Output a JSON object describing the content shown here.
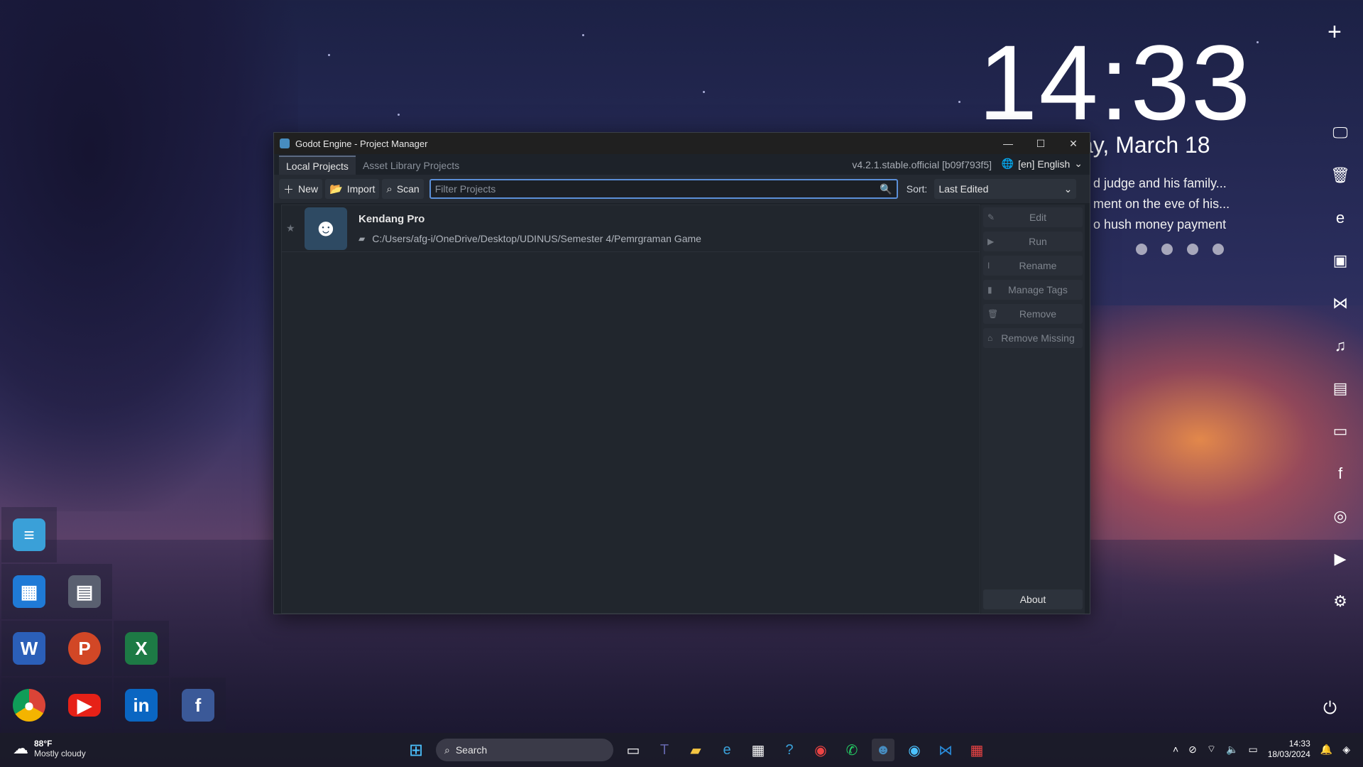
{
  "desktop": {
    "clock_time": "14:33",
    "clock_date": "ay, March 18",
    "news_lines": [
      "d judge and his family...",
      "ment on the eve of his...",
      "o hush money payment"
    ],
    "add_widget": "+"
  },
  "window": {
    "title": "Godot Engine - Project Manager",
    "tabs": [
      {
        "label": "Local Projects",
        "active": true
      },
      {
        "label": "Asset Library Projects",
        "active": false
      }
    ],
    "version": "v4.2.1.stable.official [b09f793f5]",
    "language": "[en] English",
    "toolbar": {
      "new_label": "New",
      "import_label": "Import",
      "scan_label": "Scan",
      "filter_placeholder": "Filter Projects",
      "sort_label": "Sort:",
      "sort_value": "Last Edited"
    },
    "projects": [
      {
        "name": "Kendang Pro",
        "path": "C:/Users/afg-i/OneDrive/Desktop/UDINUS/Semester 4/Pemrgraman Game"
      }
    ],
    "side_buttons": {
      "edit": "Edit",
      "run": "Run",
      "rename": "Rename",
      "manage_tags": "Manage Tags",
      "remove": "Remove",
      "remove_missing": "Remove Missing",
      "about": "About"
    }
  },
  "taskbar": {
    "temperature": "88°F",
    "condition": "Mostly cloudy",
    "search_label": "Search",
    "time": "14:33",
    "date": "18/03/2024"
  },
  "colors": {
    "accent": "#5b8fd8",
    "godot_blue": "#478cbf",
    "window_bg": "#1d2229"
  }
}
